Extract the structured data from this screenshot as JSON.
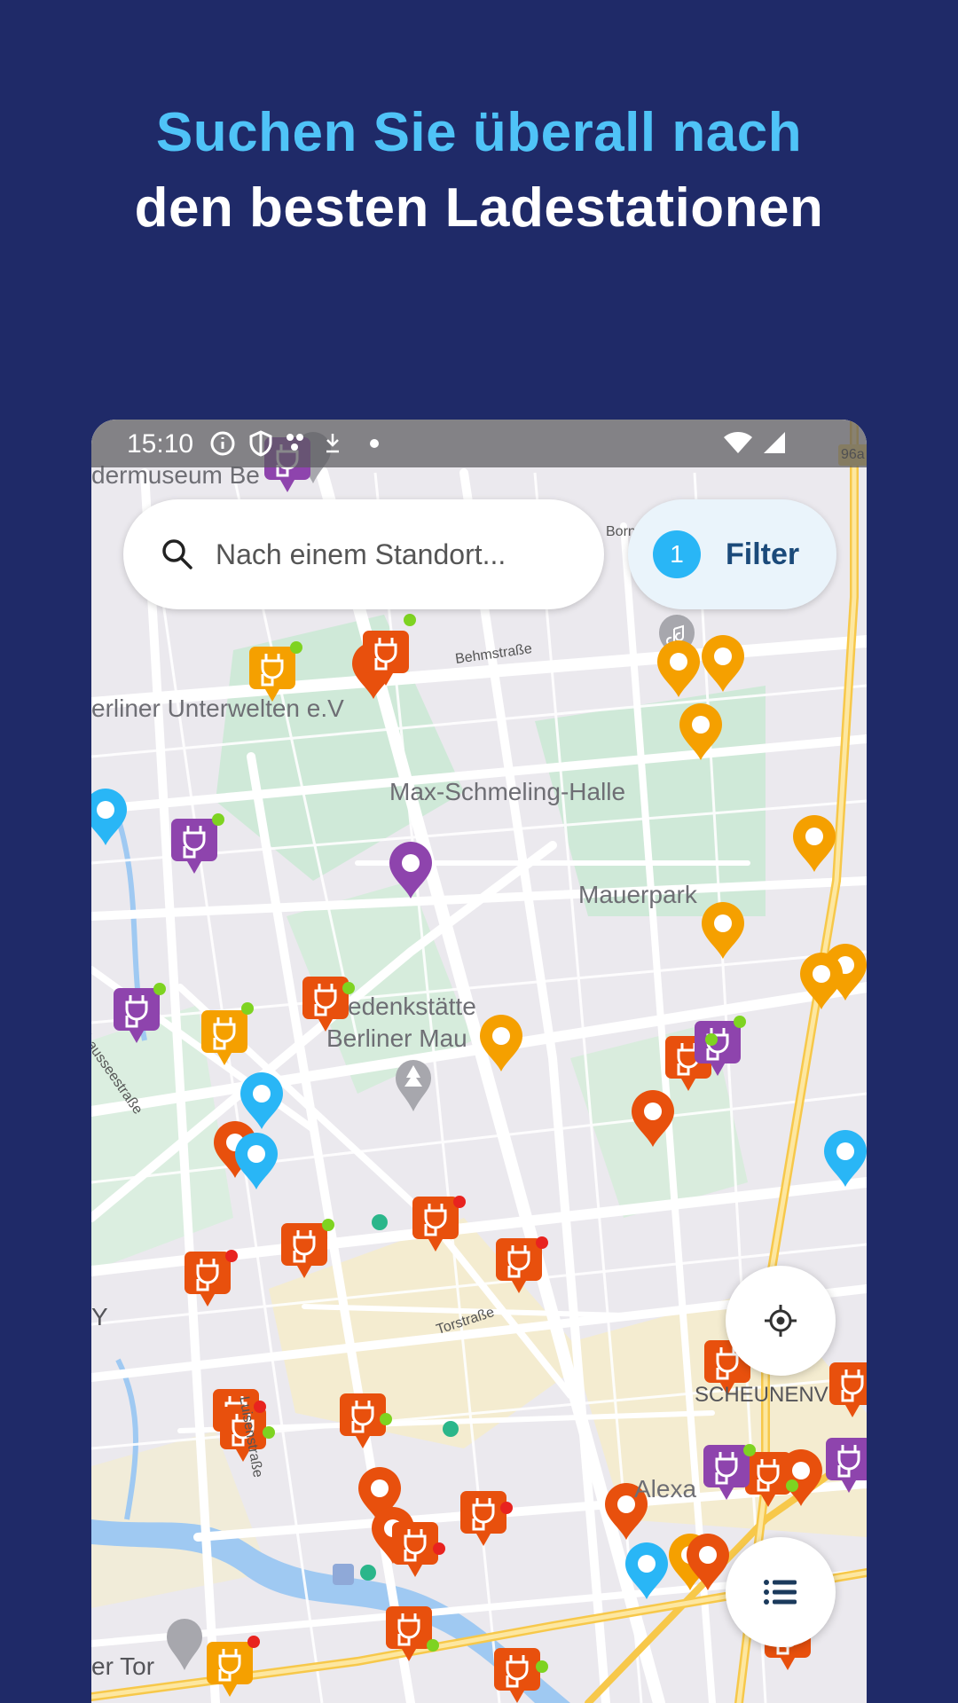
{
  "headline": {
    "line1": "Suchen Sie überall nach",
    "line2": "den besten Ladestationen"
  },
  "status_bar": {
    "time": "15:10",
    "icons": [
      "info-icon",
      "shield-icon",
      "dots-icon",
      "download-icon",
      "dot-icon",
      "wifi-icon",
      "signal-icon"
    ]
  },
  "search": {
    "placeholder": "Nach einem Standort..."
  },
  "filter": {
    "count": "1",
    "label": "Filter"
  },
  "map": {
    "labels": {
      "museum": "dermuseum Be",
      "unterwelten": "erliner Unterwelten e.V",
      "hall": "Max-Schmeling-Halle",
      "park": "Mauerpark",
      "memorial_1": "edenkstätte",
      "memorial_2": "Berliner Mau",
      "scheunen": "SCHEUNENV",
      "alex": "Alexa",
      "tor": "er Tor",
      "y": "Y",
      "road_sign": "96a"
    },
    "streets": {
      "behm": "Behmstraße",
      "tor": "Torstraße",
      "luisen": "Luisenstraße",
      "chaussee": "hausseestraße",
      "born": "Born"
    },
    "marker_colors": {
      "orange": "#f5a000",
      "red": "#e8500d",
      "purple": "#8e44ad",
      "blue": "#29b6f6"
    }
  },
  "fab": {
    "locate_icon": "crosshair-icon",
    "list_icon": "list-icon"
  }
}
